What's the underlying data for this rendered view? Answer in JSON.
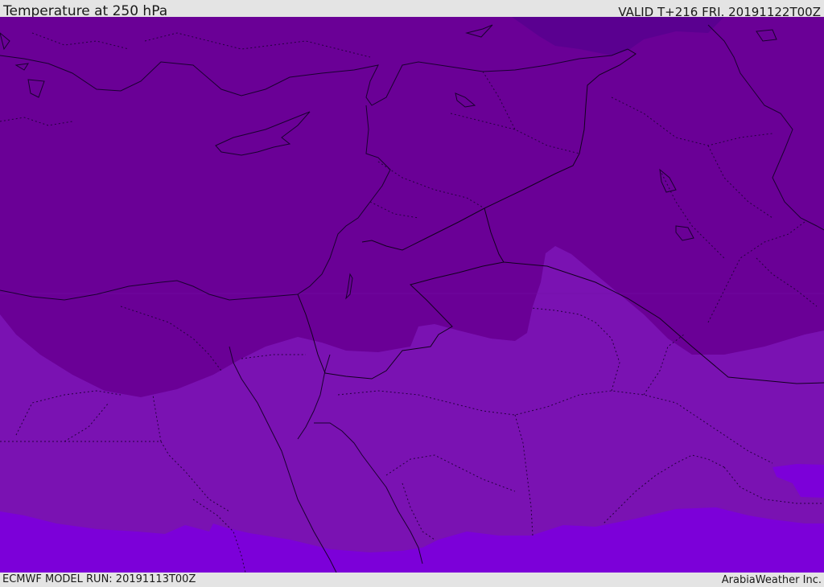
{
  "header": {
    "title": "Temperature at 250 hPa",
    "valid": "VALID T+216 FRI. 20191122T00Z"
  },
  "footer": {
    "model_run": "ECMWF MODEL RUN: 20191113T00Z",
    "credit": "ArabiaWeather Inc."
  },
  "colors": {
    "darkest_band": "#5a0090",
    "dark_band": "#6a0096",
    "mid_band": "#7a12b2",
    "light_band": "#7c00d9",
    "coastline": "#1a0030",
    "border": "#12001f"
  },
  "map": {
    "field": "temperature",
    "level": "250 hPa",
    "region": [
      "Eastern Mediterranean",
      "Middle East",
      "North Africa"
    ]
  }
}
